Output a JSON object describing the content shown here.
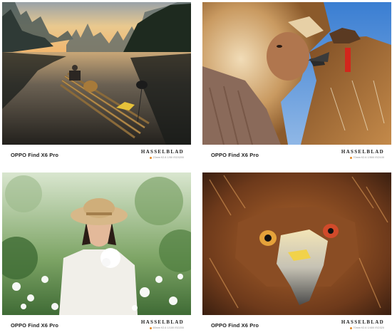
{
  "photos": [
    {
      "alt": "landscape-river-raft",
      "model": "OPPO Find X6 Pro",
      "brand": "HASSELBLAD",
      "specs": "23mm f/2.8 1/50 ISO3200"
    },
    {
      "alt": "boy-with-eagle",
      "model": "OPPO Find X6 Pro",
      "brand": "HASSELBLAD",
      "specs": "70mm f/2.6 1/500 ISO100"
    },
    {
      "alt": "woman-in-garden",
      "model": "OPPO Find X6 Pro",
      "brand": "HASSELBLAD",
      "specs": "65mm f/2.6 1/100 ISO200"
    },
    {
      "alt": "eagle-closeup",
      "model": "OPPO Find X6 Pro",
      "brand": "HASSELBLAD",
      "specs": "70mm f/2.6 1/400 ISO320"
    }
  ],
  "colors": {
    "accent": "#e58a27",
    "text": "#222222",
    "muted": "#8a8a8a"
  }
}
